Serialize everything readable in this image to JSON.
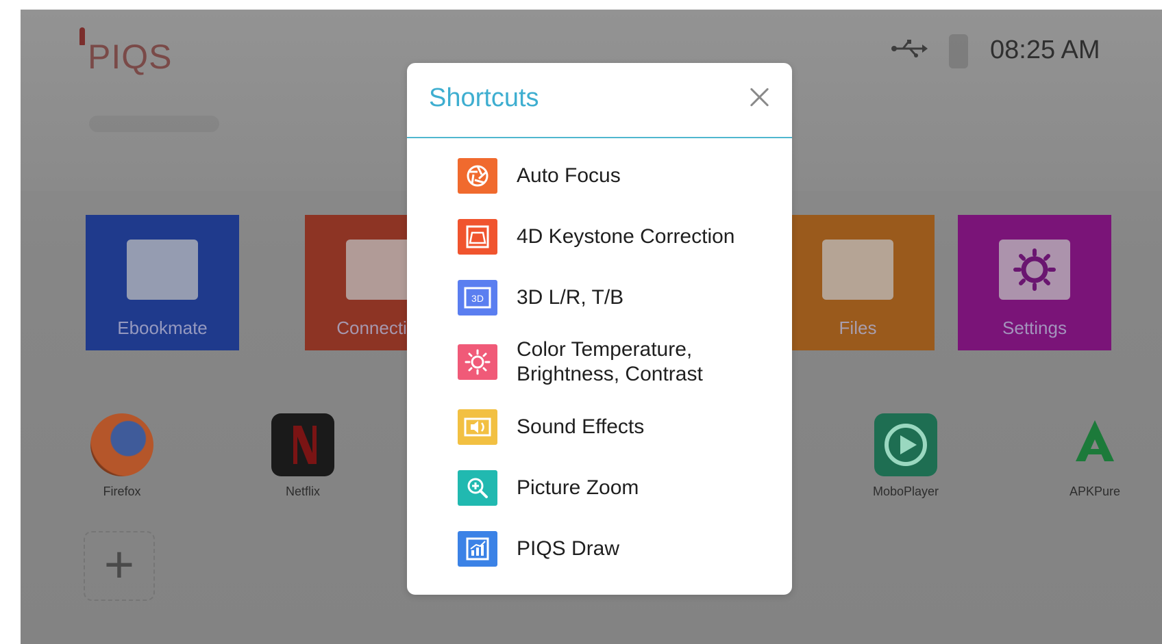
{
  "home": {
    "logo": "PIQS",
    "clock": "08:25 AM",
    "tiles": [
      {
        "label": "Ebookmate",
        "color": "#1f3a8c"
      },
      {
        "label": "Connection",
        "color": "#8d3424"
      },
      {
        "label": "Files",
        "color": "#9a5a1c"
      },
      {
        "label": "Settings",
        "color": "#7a1478"
      }
    ],
    "apps": [
      {
        "label": "Firefox",
        "icon": "firefox-icon"
      },
      {
        "label": "Netflix",
        "icon": "netflix-icon"
      },
      {
        "label": "MoboPlayer",
        "icon": "play-icon"
      },
      {
        "label": "APKPure",
        "icon": "apkpure-icon"
      }
    ],
    "add_label": "+"
  },
  "modal": {
    "title": "Shortcuts",
    "close_icon": "close-icon",
    "accent": "#3eaed0",
    "items": [
      {
        "label": "Auto Focus",
        "icon": "aperture-icon",
        "color": "#f06a2e"
      },
      {
        "label": "4D Keystone Correction",
        "icon": "keystone-icon",
        "color": "#f0542e"
      },
      {
        "label": "3D L/R, T/B",
        "icon": "3d-icon",
        "color": "#5a7ef0"
      },
      {
        "label_line1": "Color Temperature,",
        "label_line2": "Brightness, Contrast",
        "icon": "sun-icon",
        "color": "#f05a78"
      },
      {
        "label": "Sound Effects",
        "icon": "speaker-icon",
        "color": "#f2c042"
      },
      {
        "label": "Picture Zoom",
        "icon": "zoom-icon",
        "color": "#21b9b0"
      },
      {
        "label": "PIQS Draw",
        "icon": "draw-chart-icon",
        "color": "#3b82e6"
      }
    ]
  }
}
